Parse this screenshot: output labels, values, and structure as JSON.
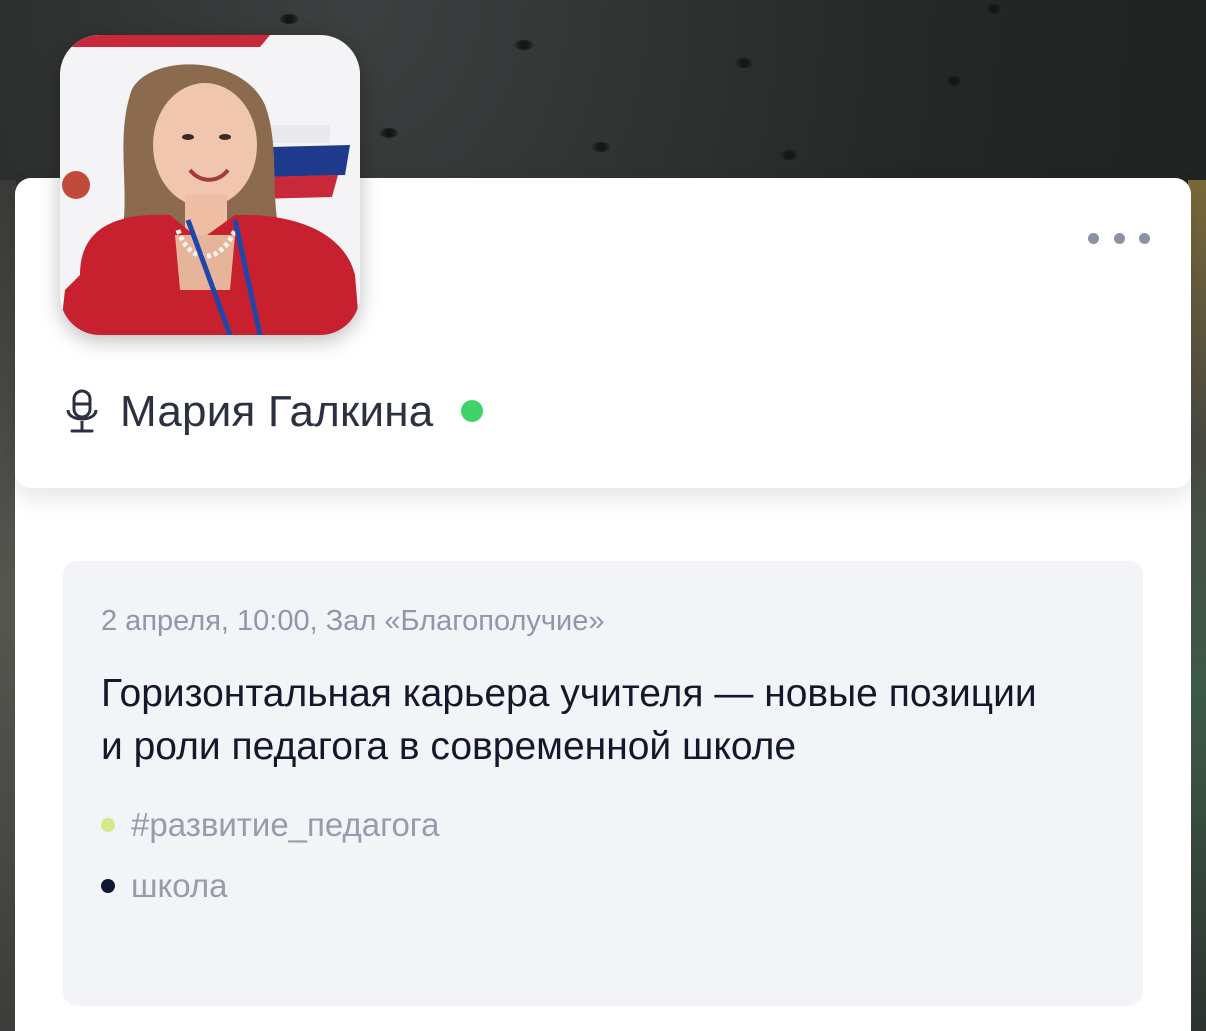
{
  "speaker": {
    "name": "Мария Галкина",
    "status": "online"
  },
  "menu": {
    "more_icon": "ellipsis-icon"
  },
  "session": {
    "meta": "2 апреля, 10:00, Зал «Благополучие»",
    "title": "Горизонтальная карьера учителя — новые позиции и роли педагога в современной школе",
    "tags": [
      {
        "label": "#развитие_педагога",
        "color": "#d6e98a"
      },
      {
        "label": "школа",
        "color": "#101933"
      }
    ]
  },
  "colors": {
    "online": "#40d36a",
    "meta_text": "#8f97a8",
    "title_text": "#14182a",
    "card_bg": "#f3f4f7"
  }
}
